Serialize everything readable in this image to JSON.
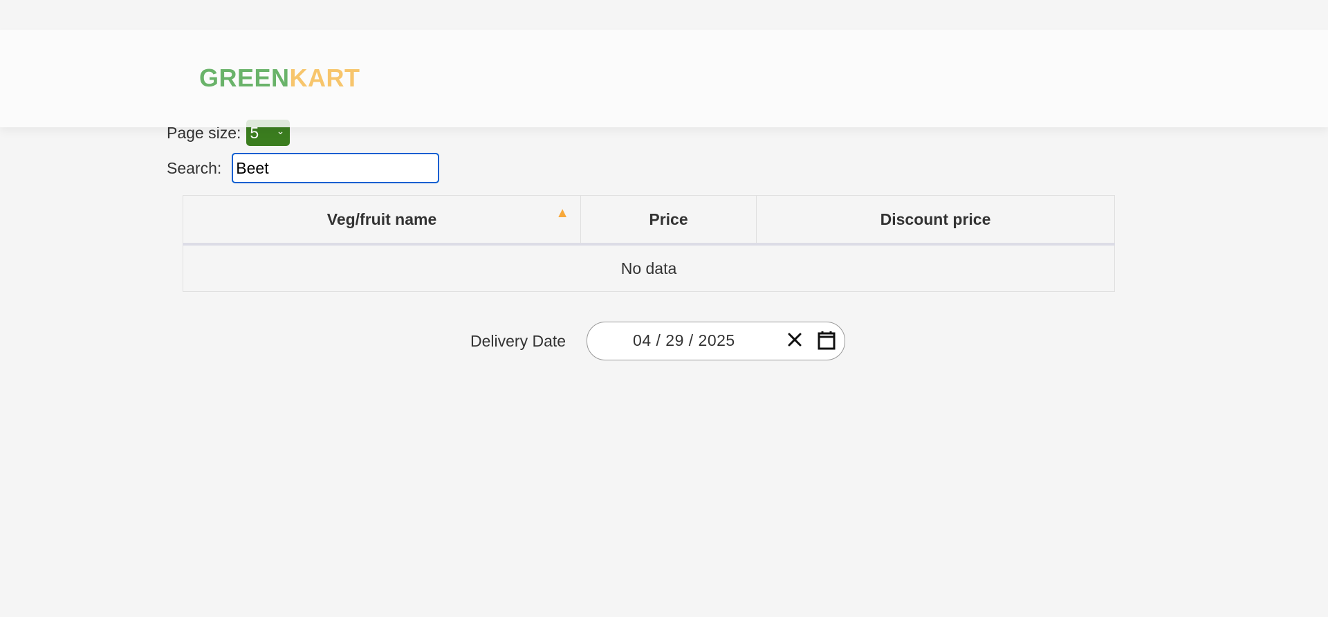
{
  "brand": {
    "part1": "GREEN",
    "part2": "KART",
    "color1": "#6ab36a",
    "color2": "#f7c56c"
  },
  "page_size": {
    "label": "Page size:",
    "selected": "5"
  },
  "search": {
    "label": "Search:",
    "value": "Beet"
  },
  "table": {
    "columns": [
      "Veg/fruit name",
      "Price",
      "Discount price"
    ],
    "sorted_column": "Veg/fruit name",
    "sort_direction": "ascending",
    "empty_text": "No data"
  },
  "delivery": {
    "label": "Delivery Date",
    "value": "04 / 29 / 2025"
  },
  "icons": {
    "sort": "chevron-up-icon",
    "clear": "close-icon",
    "calendar": "calendar-icon",
    "select": "chevron-down-icon"
  },
  "colors": {
    "select_bg": "#3b7d1f",
    "search_border": "#0b5fd1",
    "sort_icon": "#f7a83a"
  }
}
